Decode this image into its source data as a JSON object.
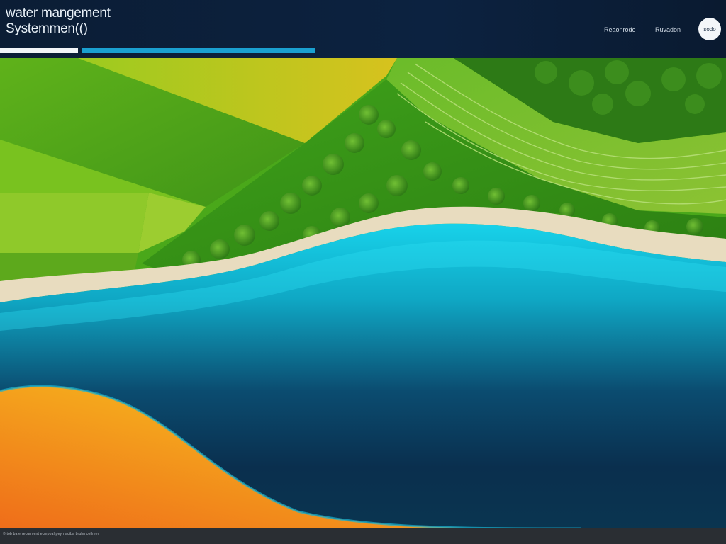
{
  "header": {
    "title_line1": "water mangement",
    "title_line2": "Systemmen(()",
    "nav": [
      "Reaonrode",
      "Ruvadon"
    ],
    "badge": "sodo"
  },
  "progress": {
    "primary": 0.11,
    "secondary": 0.32
  },
  "colors": {
    "header_bg": "#0b1d35",
    "accent": "#1aa0d0",
    "water": "#18c6e0",
    "field_green": "#6fbf1e",
    "sand": "#e8dcbf",
    "yellow": "#f5c51b",
    "orange": "#ef7a1c"
  },
  "footer": {
    "text": "© tob bate recurment ecmpoal peyrnaciba brulm cotlmer"
  }
}
